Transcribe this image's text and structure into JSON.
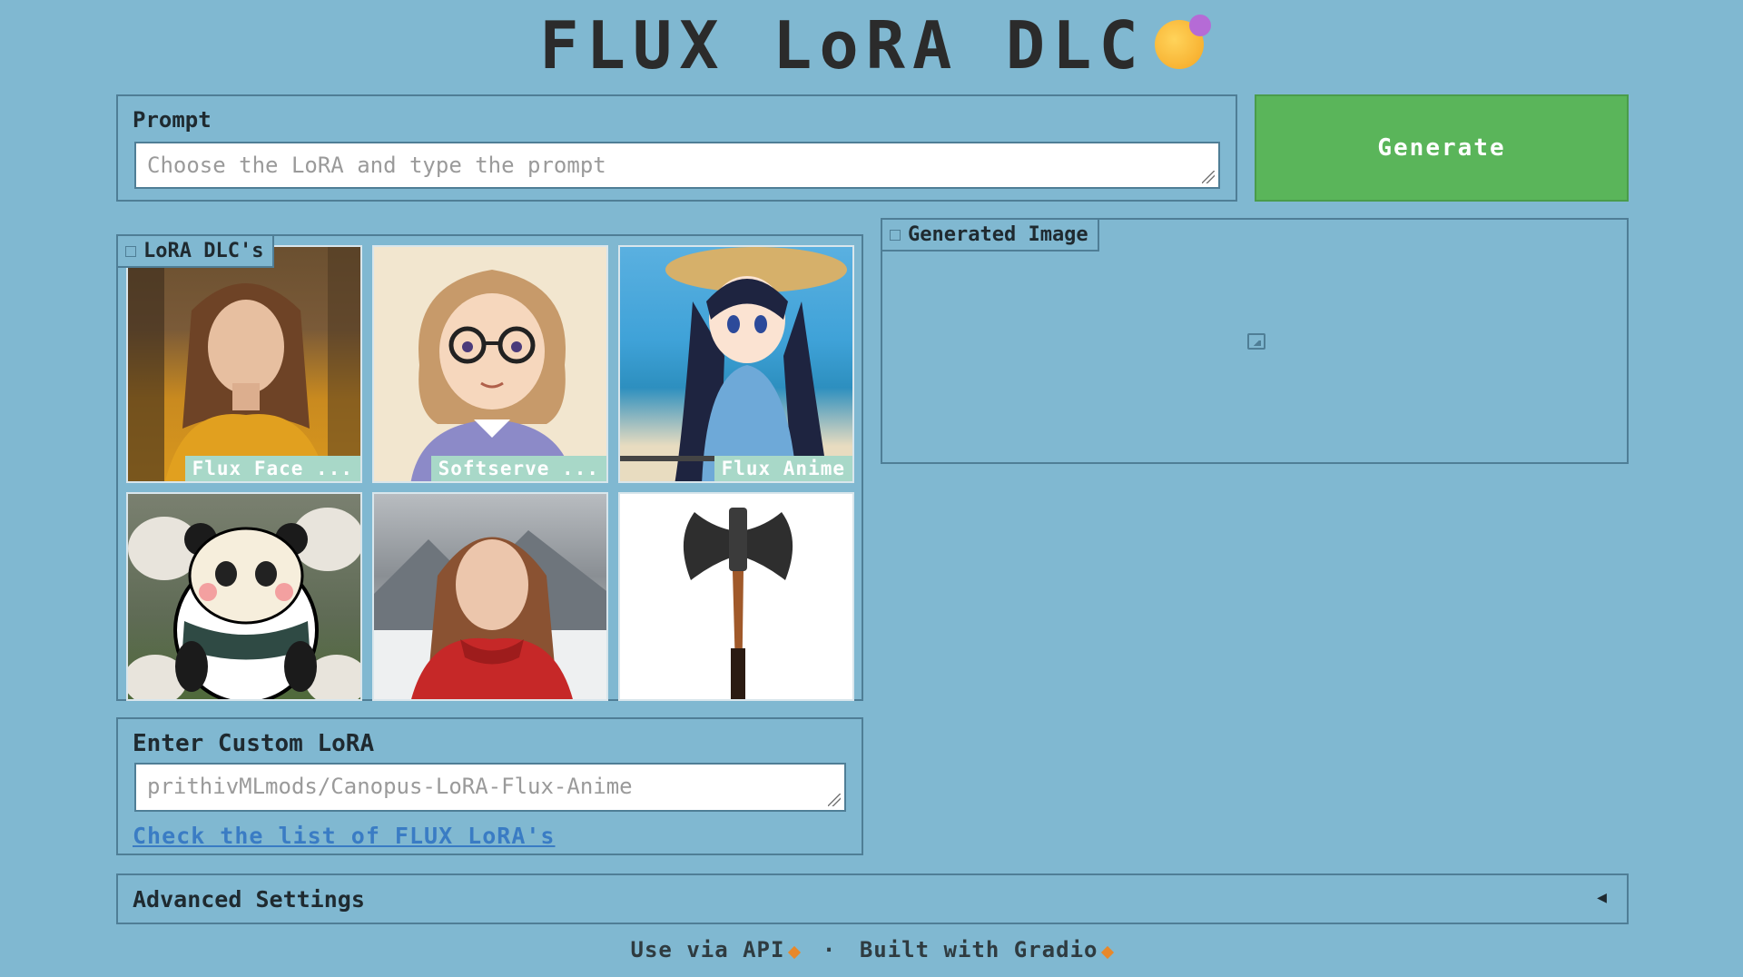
{
  "title": "FLUX LoRA DLC",
  "prompt": {
    "label": "Prompt",
    "placeholder": "Choose the LoRA and type the prompt",
    "value": ""
  },
  "generate_label": "Generate",
  "gallery": {
    "label": "LoRA DLC's",
    "items": [
      {
        "caption": "Flux Face ..."
      },
      {
        "caption": "Softserve ..."
      },
      {
        "caption": "Flux Anime"
      },
      {
        "caption": ""
      },
      {
        "caption": ""
      },
      {
        "caption": ""
      }
    ]
  },
  "generated": {
    "label": "Generated Image"
  },
  "custom_lora": {
    "label": "Enter Custom LoRA",
    "placeholder": "prithivMLmods/Canopus-LoRA-Flux-Anime",
    "value": ""
  },
  "list_link": "Check the list of FLUX LoRA's",
  "advanced_label": "Advanced Settings",
  "footer": {
    "api": "Use via API",
    "separator": "·",
    "built": "Built with Gradio"
  },
  "colors": {
    "background": "#80b8d1",
    "generate": "#5ab55a",
    "link": "#3a7cc4",
    "caption_bg": "#a8d8c8"
  }
}
